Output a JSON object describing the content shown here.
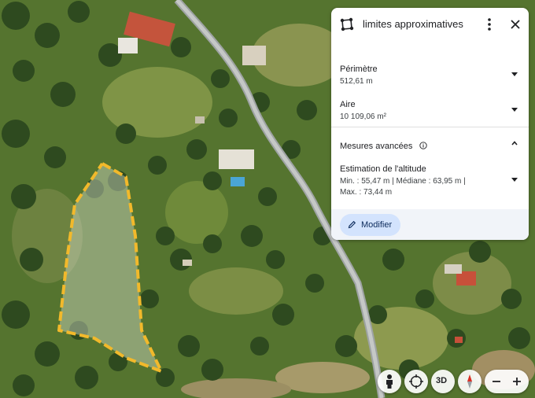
{
  "panel": {
    "title": "limites approximatives",
    "perimeter": {
      "label": "Périmètre",
      "value": "512,61 m"
    },
    "area": {
      "label": "Aire",
      "value": "10 109,06 m²"
    },
    "advanced": {
      "label": "Mesures avancées"
    },
    "altitude": {
      "label": "Estimation de l'altitude",
      "line1": "Min. : 55,47 m | Médiane : 63,95 m |",
      "line2": "Max. : 73,44 m"
    },
    "modify_label": "Modifier"
  },
  "controls": {
    "three_d_label": "3D",
    "icons": [
      "pegman-icon",
      "rotate-view-icon",
      "compass-icon",
      "zoom-out-icon",
      "zoom-in-icon"
    ]
  },
  "colors": {
    "outline": "#f2b92b",
    "button_bg": "#d3e3fd"
  }
}
